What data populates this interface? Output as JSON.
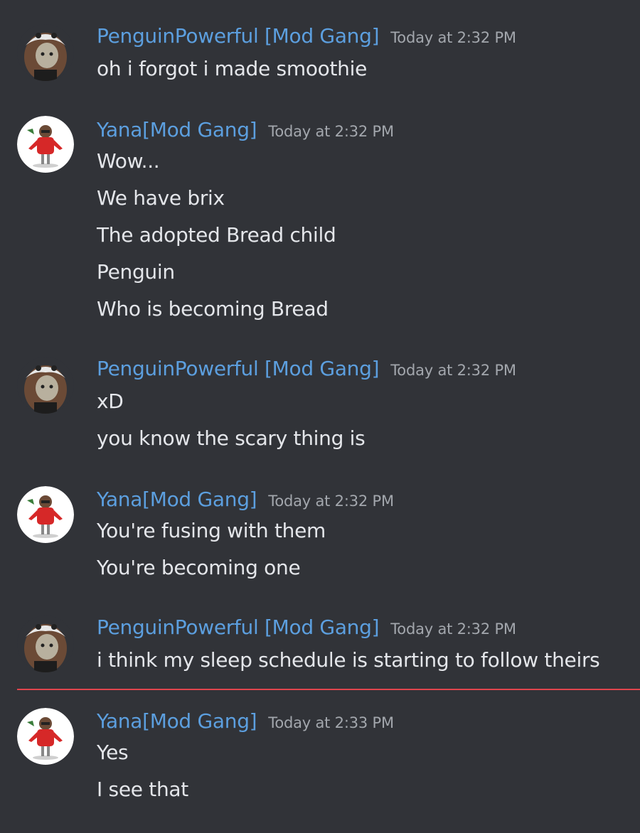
{
  "messages": [
    {
      "author": "PenguinPowerful [Mod Gang]",
      "avatar": "penguin-avatar",
      "timestamp": "Today at 2:32 PM",
      "lines": [
        "oh i forgot i made smoothie"
      ]
    },
    {
      "author": "Yana[Mod Gang]",
      "avatar": "yana-avatar",
      "timestamp": "Today at 2:32 PM",
      "lines": [
        "Wow...",
        "We have brix",
        "The adopted Bread child",
        "Penguin",
        "Who is becoming Bread"
      ]
    },
    {
      "author": "PenguinPowerful [Mod Gang]",
      "avatar": "penguin-avatar",
      "timestamp": "Today at 2:32 PM",
      "lines": [
        "xD",
        "you know the scary thing is"
      ]
    },
    {
      "author": "Yana[Mod Gang]",
      "avatar": "yana-avatar",
      "timestamp": "Today at 2:32 PM",
      "lines": [
        "You're fusing with them",
        "You're becoming one"
      ]
    },
    {
      "author": "PenguinPowerful [Mod Gang]",
      "avatar": "penguin-avatar",
      "timestamp": "Today at 2:32 PM",
      "lines": [
        "i think my sleep schedule is starting to follow theirs"
      ]
    },
    {
      "author": "Yana[Mod Gang]",
      "avatar": "yana-avatar",
      "timestamp": "Today at 2:33 PM",
      "lines": [
        "Yes",
        "I see that"
      ]
    }
  ],
  "colors": {
    "background": "#313338",
    "username": "#5c9fdf",
    "text": "#e4e6ea",
    "timestamp": "#a3a7ad",
    "new_messages_divider": "#e0454d"
  }
}
